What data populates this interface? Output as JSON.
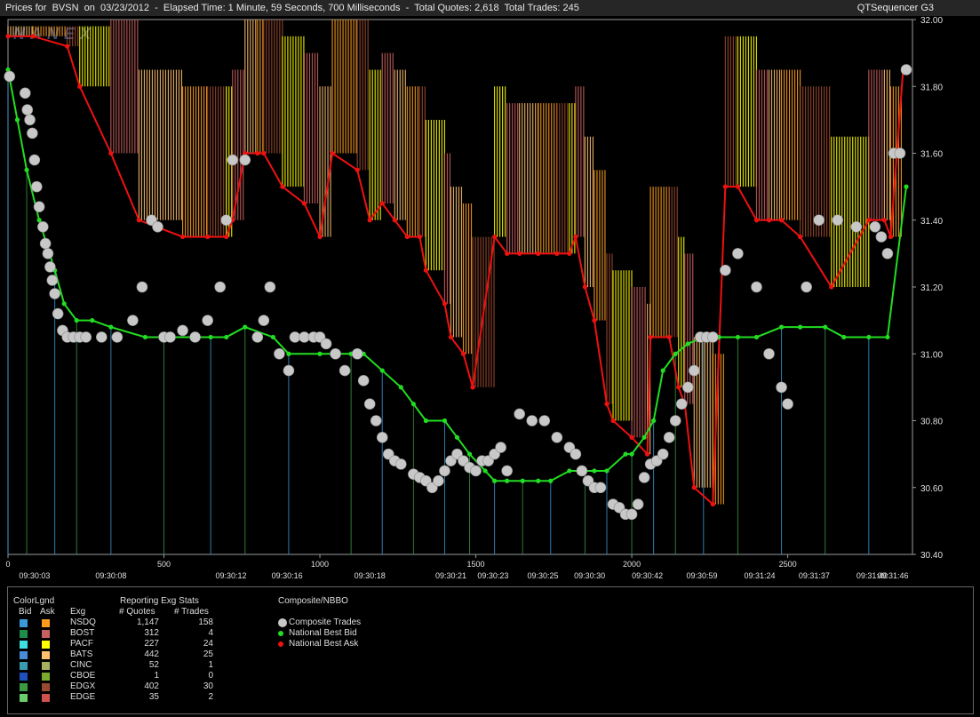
{
  "window": {
    "title": "Prices for  BVSN  on  03/23/2012  -  Elapsed Time: 1 Minute, 59 Seconds, 700 Milliseconds  -  Total Quotes: 2,618  Total Trades: 245",
    "app_name": "QTSequencer G3"
  },
  "chart_data": {
    "type": "line",
    "title": "",
    "xlabel": "",
    "ylabel": "",
    "watermark": "NANEX",
    "xlim": [
      0,
      2900
    ],
    "ylim": [
      30.4,
      32.0
    ],
    "x_ticks": [
      0,
      500,
      1000,
      1500,
      2000,
      2500
    ],
    "x_tick_labels": [
      "0",
      "500",
      "1000",
      "1500",
      "2000",
      "2500"
    ],
    "time_labels": [
      {
        "x": 85,
        "label": "09:30:03"
      },
      {
        "x": 330,
        "label": "09:30:08"
      },
      {
        "x": 715,
        "label": "09:30:12"
      },
      {
        "x": 895,
        "label": "09:30:16"
      },
      {
        "x": 1160,
        "label": "09:30:18"
      },
      {
        "x": 1420,
        "label": "09:30:21"
      },
      {
        "x": 1555,
        "label": "09:30:23"
      },
      {
        "x": 1715,
        "label": "09:30:25"
      },
      {
        "x": 1865,
        "label": "09:30:30"
      },
      {
        "x": 2050,
        "label": "09:30:42"
      },
      {
        "x": 2225,
        "label": "09:30:59"
      },
      {
        "x": 2410,
        "label": "09:31:24"
      },
      {
        "x": 2585,
        "label": "09:31:37"
      },
      {
        "x": 2770,
        "label": "09:31:40"
      },
      {
        "x": 2925,
        "label": "09:31:46"
      }
    ],
    "y_ticks": [
      30.4,
      30.6,
      30.8,
      31.0,
      31.2,
      31.4,
      31.6,
      31.8,
      32.0
    ],
    "y_tick_labels": [
      "30.40",
      "30.60",
      "30.80",
      "31.00",
      "31.20",
      "31.40",
      "31.60",
      "31.80",
      "32.00"
    ],
    "colors": {
      "trade": "#c8c8c8",
      "best_bid": "#22dd22",
      "best_ask": "#ee1111",
      "NSDQ_ask": "#ffa020",
      "BOST_ask": "#c86060",
      "PACF_ask": "#ffff00",
      "BATS_ask": "#ffc070",
      "EDGX_ask": "#9a4a30"
    },
    "series": [
      {
        "name": "National Best Ask",
        "x": [
          0,
          80,
          190,
          230,
          330,
          420,
          560,
          640,
          700,
          720,
          760,
          800,
          820,
          880,
          950,
          1000,
          1040,
          1120,
          1160,
          1200,
          1240,
          1280,
          1320,
          1340,
          1400,
          1420,
          1460,
          1490,
          1560,
          1600,
          1640,
          1700,
          1760,
          1800,
          1820,
          1850,
          1880,
          1920,
          1940,
          2000,
          2050,
          2060,
          2120,
          2150,
          2170,
          2200,
          2260,
          2300,
          2340,
          2400,
          2440,
          2480,
          2540,
          2640,
          2760,
          2810,
          2830,
          2870
        ],
        "y": [
          31.95,
          31.95,
          31.92,
          31.8,
          31.6,
          31.4,
          31.35,
          31.35,
          31.35,
          31.4,
          31.6,
          31.6,
          31.6,
          31.5,
          31.45,
          31.35,
          31.6,
          31.55,
          31.4,
          31.45,
          31.4,
          31.35,
          31.35,
          31.25,
          31.15,
          31.05,
          31.0,
          30.9,
          31.35,
          31.3,
          31.3,
          31.3,
          31.3,
          31.3,
          31.35,
          31.2,
          31.1,
          30.85,
          30.8,
          30.75,
          30.7,
          31.05,
          31.05,
          30.9,
          30.85,
          30.6,
          30.55,
          31.5,
          31.5,
          31.4,
          31.4,
          31.4,
          31.35,
          31.2,
          31.4,
          31.4,
          31.35,
          31.85
        ]
      },
      {
        "name": "National Best Bid",
        "x": [
          0,
          30,
          60,
          100,
          150,
          180,
          220,
          270,
          330,
          440,
          500,
          600,
          650,
          700,
          760,
          850,
          900,
          1000,
          1100,
          1140,
          1200,
          1260,
          1300,
          1340,
          1400,
          1440,
          1480,
          1530,
          1560,
          1600,
          1650,
          1700,
          1740,
          1800,
          1850,
          1880,
          1920,
          1980,
          2000,
          2040,
          2070,
          2100,
          2140,
          2180,
          2230,
          2280,
          2340,
          2400,
          2480,
          2540,
          2620,
          2680,
          2760,
          2820,
          2880
        ],
        "y": [
          31.85,
          31.7,
          31.55,
          31.4,
          31.25,
          31.15,
          31.1,
          31.1,
          31.08,
          31.05,
          31.05,
          31.05,
          31.05,
          31.05,
          31.08,
          31.05,
          31.0,
          31.0,
          31.0,
          31.0,
          30.95,
          30.9,
          30.85,
          30.8,
          30.8,
          30.75,
          30.7,
          30.65,
          30.62,
          30.62,
          30.62,
          30.62,
          30.62,
          30.65,
          30.65,
          30.65,
          30.65,
          30.7,
          30.7,
          30.75,
          30.8,
          30.95,
          31.0,
          31.03,
          31.05,
          31.05,
          31.05,
          31.05,
          31.08,
          31.08,
          31.08,
          31.05,
          31.05,
          31.05,
          31.5
        ]
      }
    ],
    "trades": {
      "name": "Composite Trades",
      "x": [
        5,
        55,
        62,
        70,
        78,
        85,
        92,
        100,
        112,
        120,
        128,
        135,
        142,
        150,
        160,
        175,
        190,
        210,
        230,
        250,
        300,
        350,
        400,
        430,
        460,
        480,
        500,
        520,
        560,
        600,
        640,
        680,
        700,
        720,
        760,
        800,
        820,
        840,
        870,
        900,
        920,
        950,
        980,
        1000,
        1020,
        1050,
        1080,
        1120,
        1140,
        1160,
        1180,
        1200,
        1220,
        1240,
        1260,
        1300,
        1320,
        1340,
        1360,
        1380,
        1400,
        1420,
        1440,
        1460,
        1480,
        1500,
        1520,
        1540,
        1560,
        1580,
        1600,
        1640,
        1680,
        1720,
        1760,
        1800,
        1820,
        1840,
        1860,
        1880,
        1900,
        1940,
        1960,
        1980,
        2000,
        2020,
        2040,
        2060,
        2080,
        2100,
        2120,
        2140,
        2160,
        2180,
        2200,
        2220,
        2240,
        2260,
        2300,
        2340,
        2400,
        2440,
        2480,
        2500,
        2560,
        2600,
        2660,
        2720,
        2780,
        2800,
        2820,
        2840,
        2860,
        2880
      ],
      "y": [
        31.83,
        31.78,
        31.73,
        31.7,
        31.66,
        31.58,
        31.5,
        31.44,
        31.38,
        31.33,
        31.3,
        31.26,
        31.22,
        31.18,
        31.12,
        31.07,
        31.05,
        31.05,
        31.05,
        31.05,
        31.05,
        31.05,
        31.1,
        31.2,
        31.4,
        31.38,
        31.05,
        31.05,
        31.07,
        31.05,
        31.1,
        31.2,
        31.4,
        31.58,
        31.58,
        31.05,
        31.1,
        31.2,
        31.0,
        30.95,
        31.05,
        31.05,
        31.05,
        31.05,
        31.03,
        31.0,
        30.95,
        31.0,
        30.92,
        30.85,
        30.8,
        30.75,
        30.7,
        30.68,
        30.67,
        30.64,
        30.63,
        30.62,
        30.6,
        30.62,
        30.65,
        30.68,
        30.7,
        30.68,
        30.66,
        30.65,
        30.68,
        30.68,
        30.7,
        30.72,
        30.65,
        30.82,
        30.8,
        30.8,
        30.75,
        30.72,
        30.7,
        30.65,
        30.62,
        30.6,
        30.6,
        30.55,
        30.54,
        30.52,
        30.52,
        30.55,
        30.63,
        30.67,
        30.68,
        30.7,
        30.75,
        30.8,
        30.85,
        30.9,
        30.95,
        31.05,
        31.05,
        31.05,
        31.25,
        31.3,
        31.2,
        31.0,
        30.9,
        30.85,
        31.2,
        31.4,
        31.4,
        31.38,
        31.38,
        31.35,
        31.3,
        31.6,
        31.6,
        31.85
      ]
    },
    "exchange_stats": [
      {
        "exchange": "NSDQ",
        "quotes": "1,147",
        "trades": "158",
        "bid_color": "#3a9ad9",
        "ask_color": "#ff9a1f"
      },
      {
        "exchange": "BOST",
        "quotes": "312",
        "trades": "4",
        "bid_color": "#1f8c4a",
        "ask_color": "#c86060"
      },
      {
        "exchange": "PACF",
        "quotes": "227",
        "trades": "24",
        "bid_color": "#3ee0e0",
        "ask_color": "#ffff00"
      },
      {
        "exchange": "BATS",
        "quotes": "442",
        "trades": "25",
        "bid_color": "#4a8bd8",
        "ask_color": "#ffc070"
      },
      {
        "exchange": "CINC",
        "quotes": "52",
        "trades": "1",
        "bid_color": "#3a9ab0",
        "ask_color": "#a8b060"
      },
      {
        "exchange": "CBOE",
        "quotes": "1",
        "trades": "0",
        "bid_color": "#2050c0",
        "ask_color": "#7aaa30"
      },
      {
        "exchange": "EDGX",
        "quotes": "402",
        "trades": "30",
        "bid_color": "#3a9a40",
        "ask_color": "#9a4a30"
      },
      {
        "exchange": "EDGE",
        "quotes": "35",
        "trades": "2",
        "bid_color": "#6acc6a",
        "ask_color": "#d05050"
      }
    ]
  },
  "legend": {
    "color_legend_title": "ColorLgnd",
    "bid_header": "Bid",
    "ask_header": "Ask",
    "stats_title": "Reporting Exg Stats",
    "exg_header": "Exg",
    "quotes_header": "# Quotes",
    "trades_header": "# Trades",
    "composite_title": "Composite/NBBO",
    "composite_items": [
      {
        "label": "Composite Trades",
        "color": "#c8c8c8",
        "size": 10
      },
      {
        "label": "National Best Bid",
        "color": "#22dd22",
        "size": 6
      },
      {
        "label": "National Best Ask",
        "color": "#ee1111",
        "size": 6
      }
    ]
  }
}
